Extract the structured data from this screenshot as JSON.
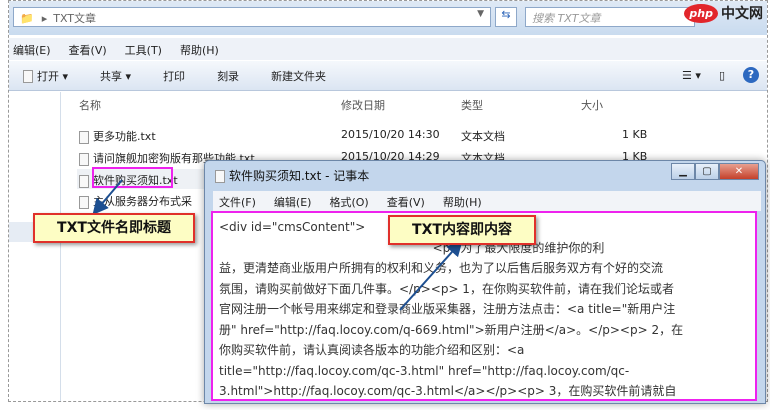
{
  "address": {
    "path": "TXT文章",
    "search_placeholder": "搜索 TXT文章"
  },
  "logo": {
    "php": "php",
    "cn": "中文网"
  },
  "menu": [
    "编辑(E)",
    "查看(V)",
    "工具(T)",
    "帮助(H)"
  ],
  "toolbar": {
    "open": "打开 ▾",
    "share": "共享 ▾",
    "print": "打印",
    "burn": "刻录",
    "new_folder": "新建文件夹"
  },
  "columns": {
    "name": "名称",
    "date": "修改日期",
    "type": "类型",
    "size": "大小"
  },
  "files": [
    {
      "name": "更多功能.txt",
      "date": "2015/10/20 14:30",
      "type": "文本文档",
      "size": "1 KB"
    },
    {
      "name": "请问旗舰加密狗版有那些功能.txt",
      "date": "2015/10/20 14:29",
      "type": "文本文档",
      "size": "1 KB"
    },
    {
      "name": "软件购买须知.txt",
      "date": "",
      "type": "",
      "size": ""
    },
    {
      "name": "主从服务器分布式采",
      "date": "",
      "type": "",
      "size": ""
    }
  ],
  "notepad": {
    "title": "软件购买须知.txt - 记事本",
    "menu": [
      "文件(F)",
      "编辑(E)",
      "格式(O)",
      "查看(V)",
      "帮助(H)"
    ],
    "lines": [
      "<div id=\"cmsContent\">",
      "                                                        <p>为了最大限度的维护你的利",
      "益，更清楚商业版用户所拥有的权利和义务，也为了以后售后服务双方有个好的交流",
      "氛围，请购买前做好下面几件事。</p><p> 1，在你购买软件前，请在我们论坛或者",
      "官网注册一个帐号用来绑定和登录商业版采集器，注册方法点击：<a title=\"新用户注",
      "册\" href=\"http://faq.locoy.com/q-669.html\">新用户注册</a>。</p><p> 2，在",
      "你购买软件前，请认真阅读各版本的功能介绍和区别：<a",
      "title=\"http://faq.locoy.com/qc-3.html\" href=\"http://faq.locoy.com/qc-",
      "3.html\">http://faq.locoy.com/qc-3.html</a></p><p> 3，在购买软件前请就自"
    ]
  },
  "callouts": {
    "filename": "TXT文件名即标题",
    "content": "TXT内容即内容"
  }
}
